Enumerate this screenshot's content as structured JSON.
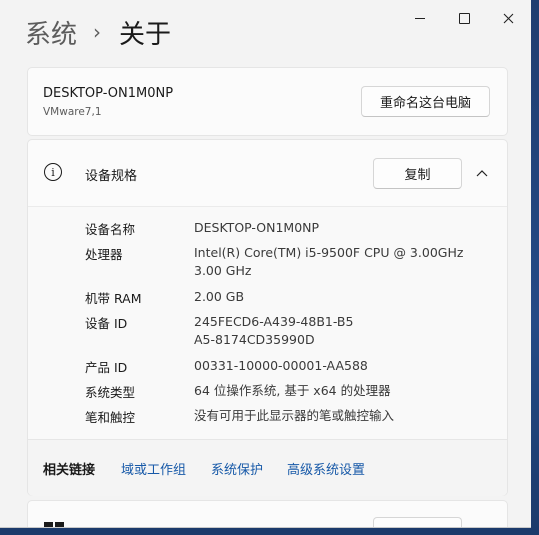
{
  "window": {
    "controls": {
      "minimize": "minimize",
      "maximize": "maximize",
      "close": "close"
    }
  },
  "breadcrumb": {
    "parent": "系统",
    "separator": "›",
    "current": "关于"
  },
  "device": {
    "name": "DESKTOP-ON1M0NP",
    "model": "VMware7,1",
    "rename_label": "重命名这台电脑"
  },
  "specs": {
    "title": "设备规格",
    "copy_label": "复制",
    "rows": [
      {
        "label": "设备名称",
        "value": "DESKTOP-ON1M0NP"
      },
      {
        "label": "处理器",
        "value": "Intel(R) Core(TM) i5-9500F CPU @ 3.00GHz 3.00 GHz"
      },
      {
        "label": "机带 RAM",
        "value": "2.00 GB"
      },
      {
        "label": "设备 ID",
        "value": "245FECD6-A439-48B1-B5A5-8174CD35990D"
      },
      {
        "label": "产品 ID",
        "value": "00331-10000-00001-AA588"
      },
      {
        "label": "系统类型",
        "value": "64 位操作系统, 基于 x64 的处理器"
      },
      {
        "label": "笔和触控",
        "value": "没有可用于此显示器的笔或触控输入"
      }
    ]
  },
  "related": {
    "label": "相关链接",
    "links": [
      "域或工作组",
      "系统保护",
      "高级系统设置"
    ]
  },
  "colors": {
    "accent_link": "#1759a8",
    "background": "#f3f3f3",
    "card": "#fbfbfb"
  }
}
